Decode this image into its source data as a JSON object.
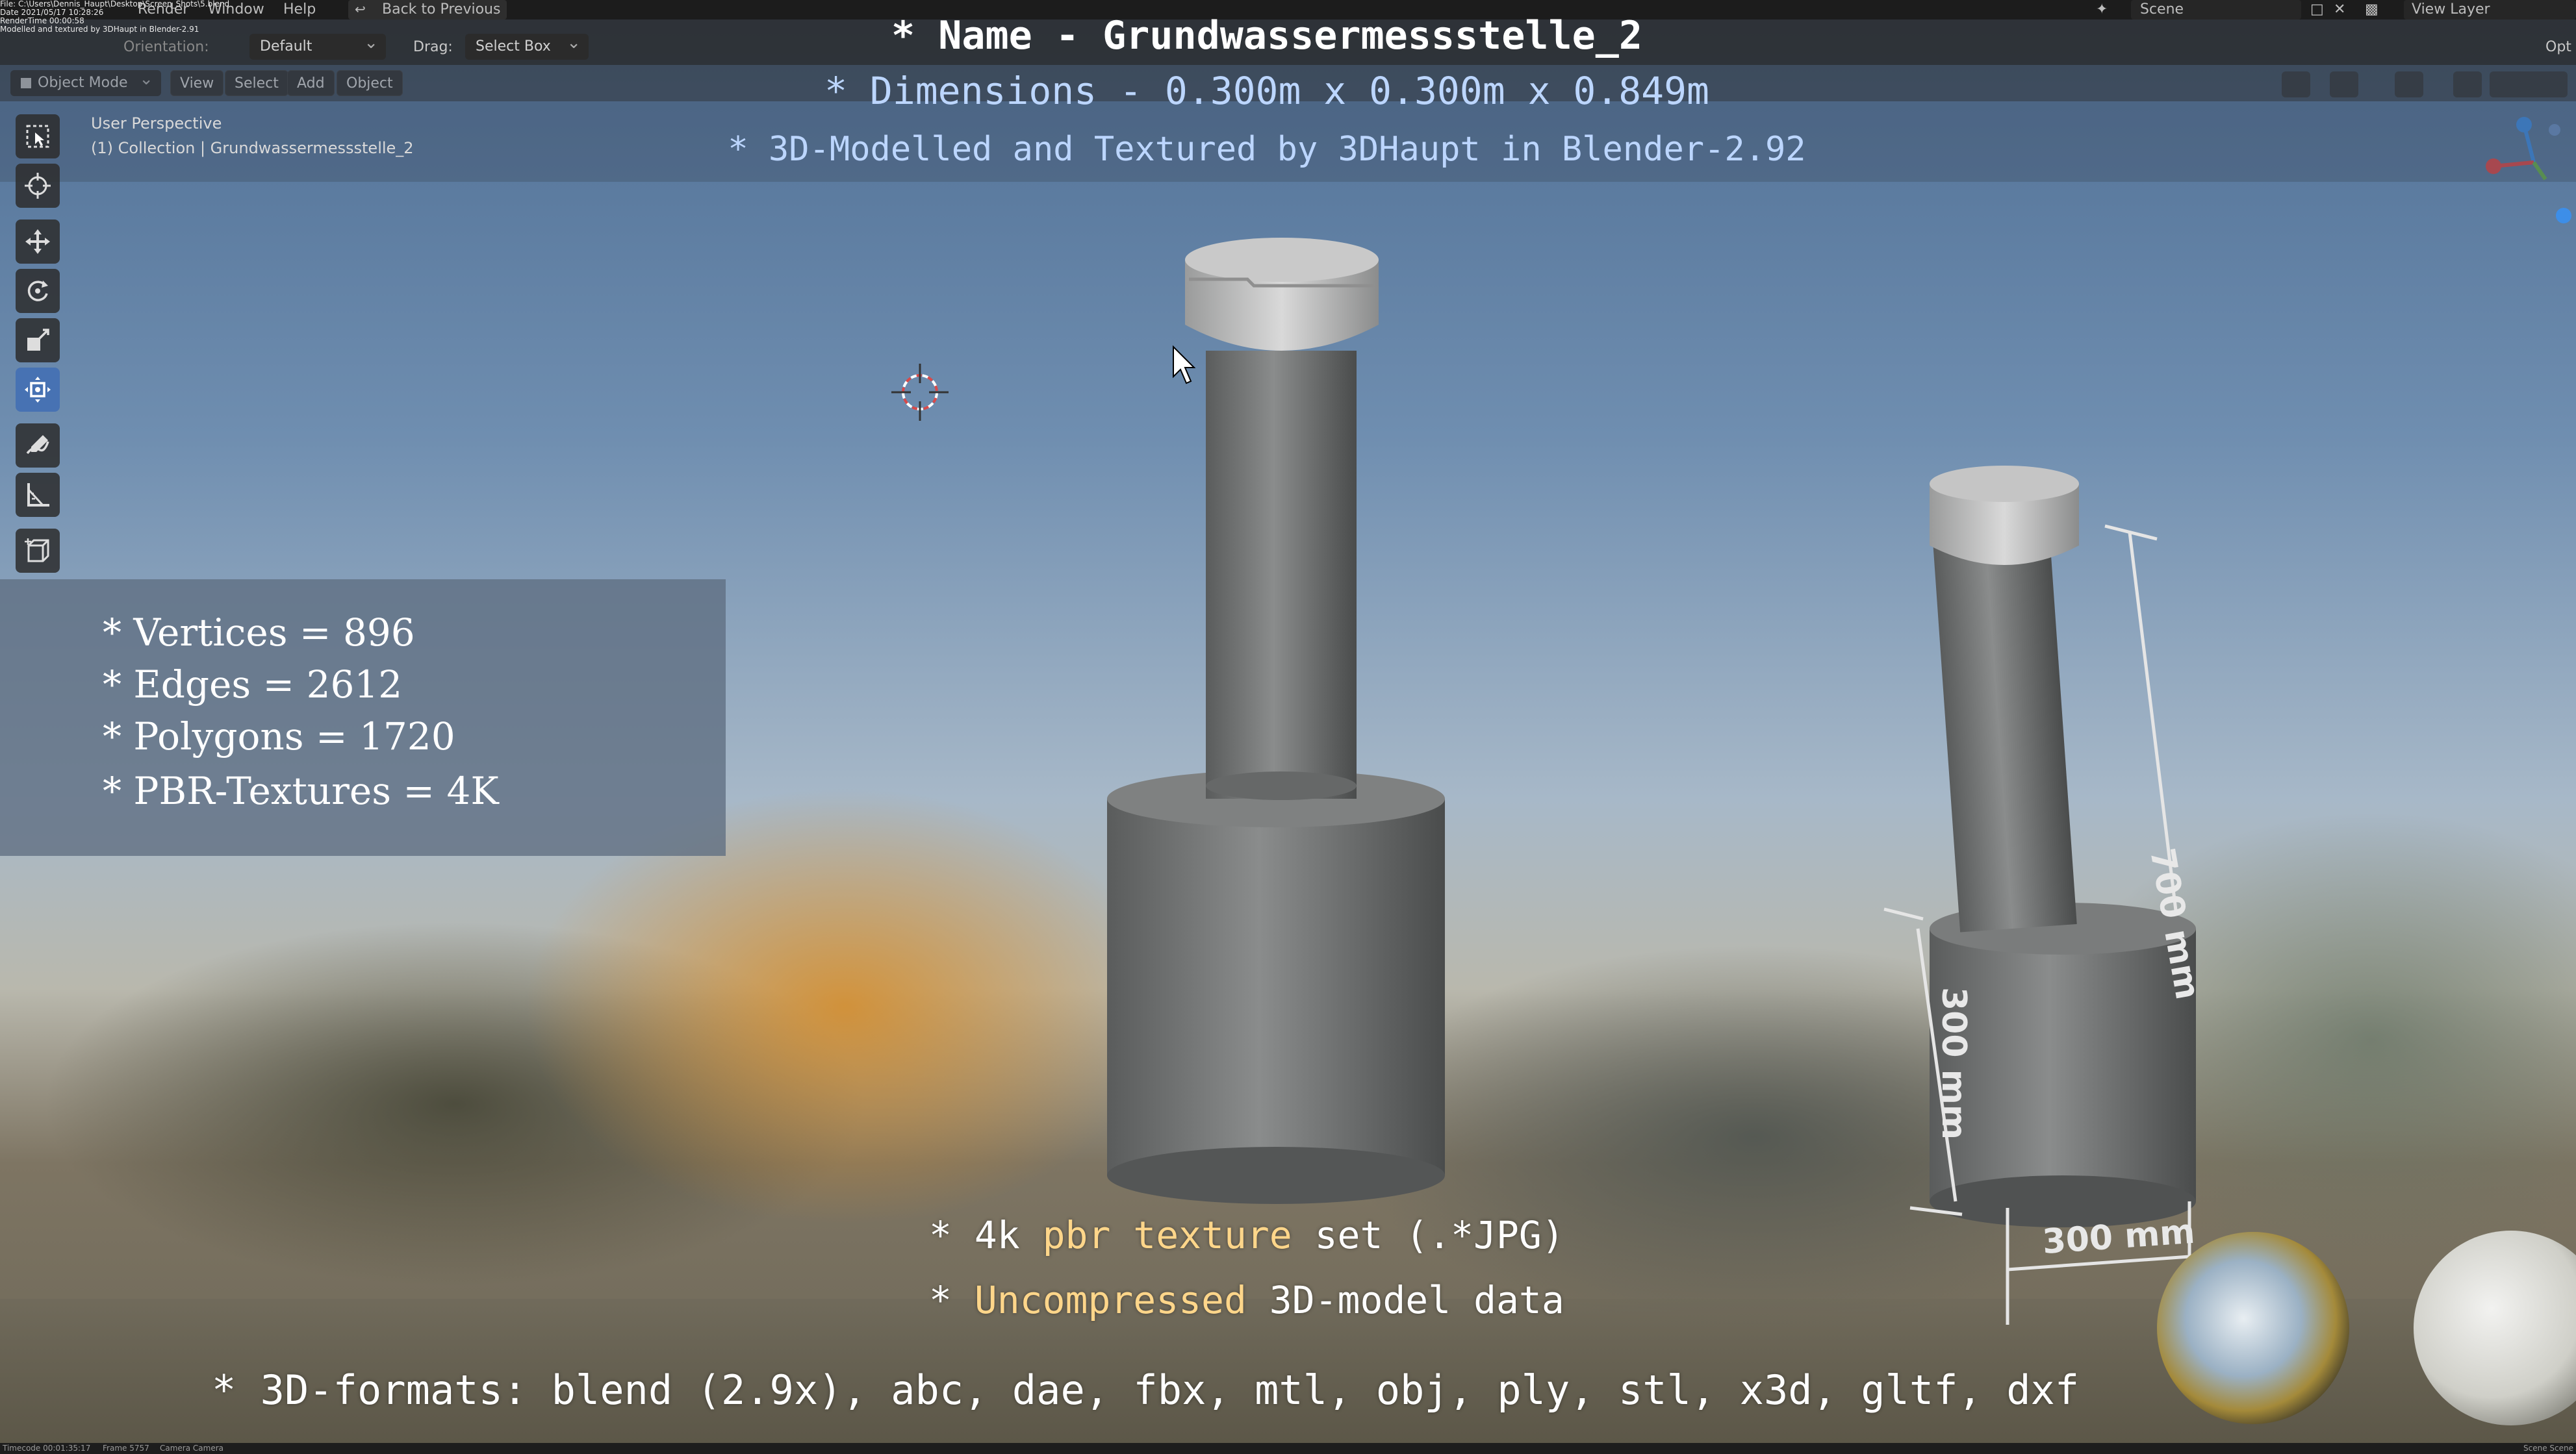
{
  "topbar": {
    "file_path": "File: C:\\Users\\Dennis_Haupt\\Desktop\\Screen_Shots\\5.blend",
    "date": "Date 2021/05/17 10:28:26",
    "render_time": "RenderTime 00:00:58",
    "credit_small": "Modelled and textured by 3DHaupt in Blender-2.91",
    "menu_render": "Render",
    "menu_window": "Window",
    "menu_help": "Help",
    "back_to_previous": "Back to Previous",
    "scene": "Scene",
    "view_layer": "View Layer"
  },
  "header": {
    "orientation_label": "Orientation:",
    "orientation_value": "Default",
    "drag_label": "Drag:",
    "drag_value": "Select Box",
    "options_label": "Opt"
  },
  "toolbar": {
    "mode": "Object Mode",
    "view": "View",
    "select": "Select",
    "add": "Add",
    "object": "Object"
  },
  "viewport": {
    "perspective": "User Perspective",
    "collection": "(1) Collection | Grundwassermessstelle_2",
    "dim_label_vertical": "700 mm",
    "dim_label_left": "300 mm",
    "dim_label_bottom": "300 mm"
  },
  "overlay": {
    "name_line": "* Name - Grundwassermessstelle_2",
    "dimensions_line": "* Dimensions -  0.300m x 0.300m x 0.849m",
    "credit_line": "* 3D-Modelled and Textured by 3DHaupt in Blender-2.92"
  },
  "stats": {
    "vertices": "* Vertices = 896",
    "edges": "* Edges = 2612",
    "polygons": "* Polygons = 1720",
    "textures": "* PBR-Textures = 4K"
  },
  "bottom": {
    "line1_prefix": "* 4k ",
    "line1_highlight": "pbr texture",
    "line1_suffix": " set (.*JPG)",
    "line2_prefix": "* ",
    "line2_highlight": "Uncompressed",
    "line2_suffix": " 3D-model data",
    "formats": "* 3D-formats: blend (2.9x), abc, dae, fbx, mtl, obj, ply, stl, x3d, gltf, dxf"
  },
  "statusbar": {
    "timecode": "Timecode 00:01:35:17",
    "frame": "Frame 5757",
    "camera": "Camera Camera",
    "scene": "Scene Scene"
  },
  "colors": {
    "accent": "#4772b3",
    "overlay_blue": "#bcd6ff",
    "highlight": "#ffd68a"
  }
}
